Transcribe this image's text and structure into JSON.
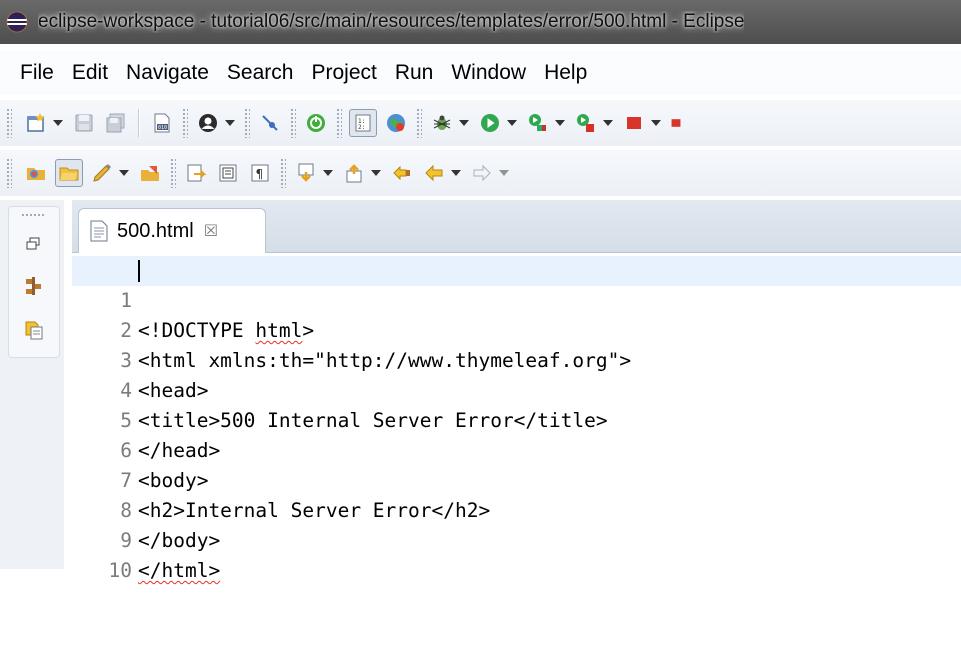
{
  "window": {
    "title": "eclipse-workspace - tutorial06/src/main/resources/templates/error/500.html - Eclipse"
  },
  "menu": [
    "File",
    "Edit",
    "Navigate",
    "Search",
    "Project",
    "Run",
    "Window",
    "Help"
  ],
  "toolbar_icons_row1": [
    "new-wizard-icon",
    "save-icon",
    "save-all-icon",
    "binary-file-icon",
    "profile-icon",
    "skip-breakpoints-icon",
    "spring-boot-icon",
    "toggle-block-selection-icon",
    "web-browser-icon",
    "debug-icon",
    "run-icon",
    "run-coverage-icon",
    "external-tools-icon",
    "terminate-icon"
  ],
  "toolbar_icons_row2": [
    "open-folder-icon",
    "open-type-icon",
    "highlight-icon",
    "open-task-icon",
    "toggle-mark-occurrences-icon",
    "show-whitespace-icon",
    "paragraph-icon",
    "next-annotation-icon",
    "previous-annotation-icon",
    "last-edit-location-icon",
    "back-icon",
    "forward-icon"
  ],
  "editor": {
    "tab": {
      "label": "500.html",
      "close_glyph": "☒"
    },
    "lines": [
      {
        "num": "1",
        "parts": [
          "<",
          "!DOCTYPE ",
          "html",
          ">"
        ]
      },
      {
        "num": "2",
        "text": "<html xmlns:th=\"http://www.thymeleaf.org\">"
      },
      {
        "num": "3",
        "text": "<head>"
      },
      {
        "num": "4",
        "text": "<title>500 Internal Server Error</title>"
      },
      {
        "num": "5",
        "text": "</head>"
      },
      {
        "num": "6",
        "text": "<body>"
      },
      {
        "num": "7",
        "text": "<h2>Internal Server Error</h2>"
      },
      {
        "num": "8",
        "text": "</body>"
      },
      {
        "num": "9",
        "text": "</html>"
      },
      {
        "num": "10",
        "text": ""
      }
    ]
  },
  "colors": {
    "error_squiggle": "#e0352b",
    "current_line": "#e8f2fe"
  }
}
